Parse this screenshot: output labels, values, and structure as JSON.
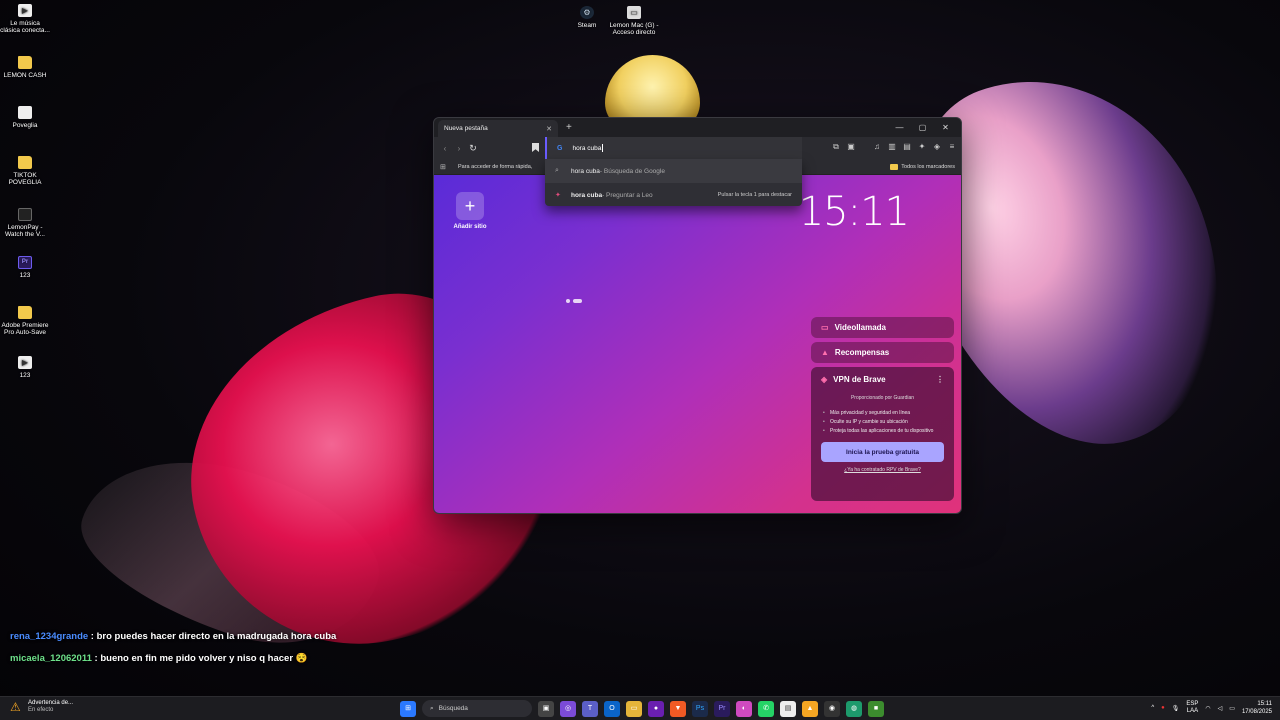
{
  "desktop_icons": [
    {
      "label": "Le música clásica conecta...",
      "icon": "file-icon"
    },
    {
      "label": "LEMON CASH",
      "icon": "folder-icon"
    },
    {
      "label": "Poveglia",
      "icon": "file-icon"
    },
    {
      "label": "TIKTOK POVEGLIA",
      "icon": "folder-icon"
    },
    {
      "label": "LemonPay - Watch the V...",
      "icon": "video-icon"
    },
    {
      "label": "123",
      "icon": "premiere-icon"
    },
    {
      "label": "Adobe Premiere Pro Auto-Save",
      "icon": "folder-icon"
    },
    {
      "label": "123",
      "icon": "file-icon"
    }
  ],
  "top_icons": [
    {
      "label": "Steam",
      "icon": "steam-icon"
    },
    {
      "label": "Lemon Mac (G) - Acceso directo",
      "icon": "drive-icon"
    }
  ],
  "browser": {
    "tab_title": "Nueva pestaña",
    "address_value": "hora cuba",
    "bookmark_hint": "Para acceder de forma rápida,",
    "all_bookmarks": "Todos los marcadores",
    "suggestions": [
      {
        "main": "hora cuba",
        "sub": " - Búsqueda de Google",
        "hint": ""
      },
      {
        "main": "hora cuba",
        "sub": " - Preguntar a Leo",
        "hint": "Pulsar la tecla 1 para destacar"
      }
    ],
    "add_site": "Añadir sitio",
    "clock": "15:11",
    "widgets": {
      "video_call": "Videollamada",
      "rewards": "Recompensas",
      "vpn_title": "VPN de Brave",
      "vpn_by": "Proporcionado por  Guardian",
      "vpn_features": [
        "Más privacidad y seguridad en línea",
        "Oculte su IP y cambie su ubicación",
        "Proteja todas las aplicaciones de tu dispositivo"
      ],
      "vpn_button": "Inicia la prueba gratuita",
      "vpn_link": "¿Ya ha contratado RPV de Brave?"
    }
  },
  "chat": [
    {
      "user": "rena_1234grande",
      "message": " : bro puedes hacer directo en la madrugada hora cuba"
    },
    {
      "user": "micaela_12062011",
      "message": " : bueno en fin me pido volver y niso q hacer 😵"
    }
  ],
  "taskbar": {
    "weather_title": "Advertencia de...",
    "weather_sub": "En efecto",
    "search_placeholder": "Búsqueda",
    "lang_top": "ESP",
    "lang_bottom": "LAA",
    "time": "15:11",
    "date": "17/08/2025"
  },
  "colors": {
    "accent": "#6a5cff",
    "vpn_button": "#a9a4ff",
    "chat_user1": "#4a8cff",
    "chat_user2": "#6de08a"
  }
}
